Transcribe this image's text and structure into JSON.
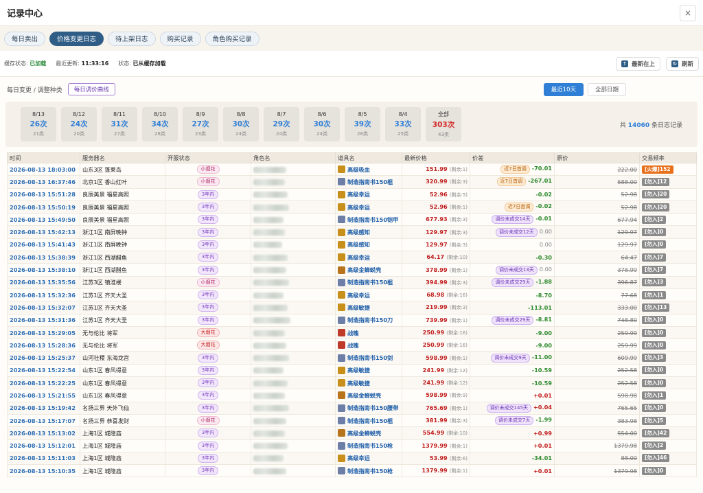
{
  "window": {
    "title": "记录中心",
    "close": "×"
  },
  "tabs": [
    {
      "label": "每日卖出"
    },
    {
      "label": "价格变更日志",
      "active": true
    },
    {
      "label": "待上架日志"
    },
    {
      "label": "购买记录"
    },
    {
      "label": "角色购买记录"
    }
  ],
  "status": {
    "cache_label": "缓存状态:",
    "cache_value": "已加载",
    "update_label": "最近更新:",
    "update_value": "11:33:16",
    "state_label": "状态:",
    "state_value": "已从缓存加载",
    "latest_first": "最新在上",
    "refresh": "刷新"
  },
  "filter": {
    "label": "每日变更 / 调整种类",
    "curve_button": "每日调价曲线",
    "range_recent": "最近10天",
    "range_all": "全部日期",
    "total_prefix": "共",
    "total_count": "14060",
    "total_suffix": "条日志记录"
  },
  "days": [
    {
      "date": "8/13",
      "count": "26次",
      "kinds": "21类"
    },
    {
      "date": "8/12",
      "count": "24次",
      "kinds": "20类"
    },
    {
      "date": "8/11",
      "count": "31次",
      "kinds": "27类"
    },
    {
      "date": "8/10",
      "count": "34次",
      "kinds": "28类"
    },
    {
      "date": "8/9",
      "count": "27次",
      "kinds": "23类"
    },
    {
      "date": "8/8",
      "count": "30次",
      "kinds": "24类"
    },
    {
      "date": "8/7",
      "count": "29次",
      "kinds": "24类"
    },
    {
      "date": "8/6",
      "count": "30次",
      "kinds": "24类"
    },
    {
      "date": "8/5",
      "count": "39次",
      "kinds": "28类"
    },
    {
      "date": "8/4",
      "count": "33次",
      "kinds": "25类"
    },
    {
      "date": "全部",
      "count": "303次",
      "kinds": "43类",
      "all": true
    }
  ],
  "columns": [
    "时间",
    "服务器名",
    "开服状态",
    "角色名",
    "道具名",
    "最新价格",
    "价差",
    "原价",
    "交易频率"
  ],
  "icon_colors": {
    "gold": "#c8901a",
    "book": "#6d7fa6",
    "bug": "#b8741a",
    "red": "#c03a2a"
  },
  "rows": [
    {
      "time": "2026-08-13 18:03:00",
      "server": "山东3区 蓬莱岛",
      "status": "小烟花",
      "st": "ps",
      "item": "高级吸血",
      "icon": "gold",
      "price": "151.99",
      "rem": "(剩余:1)",
      "tag": "近7日首调",
      "tt": "first",
      "diff": "-70.01",
      "dk": "neg",
      "orig": "222.00",
      "freq": "[火爆]152",
      "hot": true
    },
    {
      "time": "2026-08-13 16:37:46",
      "server": "北京1区 香山红叶",
      "status": "小烟花",
      "st": "ps",
      "item": "制造指南书150棍",
      "icon": "book",
      "price": "320.99",
      "rem": "(剩余:3)",
      "tag": "近7日首调",
      "tt": "first",
      "diff": "-267.01",
      "dk": "neg",
      "orig": "588.00",
      "freq": "[勿入]12"
    },
    {
      "time": "2026-08-13 15:51:28",
      "server": "良辰美景 福星高照",
      "status": "3年内",
      "st": "p3",
      "item": "高级幸运",
      "icon": "gold",
      "price": "52.96",
      "rem": "(剩余:5)",
      "tag": "",
      "tt": "",
      "diff": "-0.02",
      "dk": "neg",
      "orig": "52.98",
      "freq": "[勿入]20"
    },
    {
      "time": "2026-08-13 15:50:19",
      "server": "良辰美景 福星高照",
      "status": "3年内",
      "st": "p3",
      "item": "高级幸运",
      "icon": "gold",
      "price": "52.96",
      "rem": "(剩余:1)",
      "tag": "近7日首调",
      "tt": "first",
      "diff": "-0.02",
      "dk": "neg",
      "orig": "52.98",
      "freq": "[勿入]20"
    },
    {
      "time": "2026-08-13 15:49:50",
      "server": "良辰美景 福星高照",
      "status": "3年内",
      "st": "p3",
      "item": "制造指南书150铠甲",
      "icon": "book",
      "price": "677.93",
      "rem": "(剩余:3)",
      "tag": "调价未成交14天",
      "tt": "none",
      "diff": "-0.01",
      "dk": "neg",
      "orig": "677.94",
      "freq": "[勿入]2"
    },
    {
      "time": "2026-08-13 15:42:13",
      "server": "浙江1区 南屏晚钟",
      "status": "3年内",
      "st": "p3",
      "item": "高级感知",
      "icon": "gold",
      "price": "129.97",
      "rem": "(剩余:3)",
      "tag": "调价未成交12天",
      "tt": "none",
      "diff": "0.00",
      "dk": "zero",
      "orig": "129.97",
      "freq": "[勿入]0"
    },
    {
      "time": "2026-08-13 15:41:43",
      "server": "浙江1区 南屏晚钟",
      "status": "3年内",
      "st": "p3",
      "item": "高级感知",
      "icon": "gold",
      "price": "129.97",
      "rem": "(剩余:3)",
      "tag": "",
      "tt": "",
      "diff": "0.00",
      "dk": "zero",
      "orig": "129.97",
      "freq": "[勿入]0"
    },
    {
      "time": "2026-08-13 15:38:39",
      "server": "浙江1区 西湖醋鱼",
      "status": "3年内",
      "st": "p3",
      "item": "高级幸运",
      "icon": "gold",
      "price": "64.17",
      "rem": "(剩余:10)",
      "tag": "",
      "tt": "",
      "diff": "-0.30",
      "dk": "neg",
      "orig": "64.47",
      "freq": "[勿入]7"
    },
    {
      "time": "2026-08-13 15:38:10",
      "server": "浙江1区 西湖醋鱼",
      "status": "3年内",
      "st": "p3",
      "item": "高级金蝉蜕壳",
      "icon": "bug",
      "price": "378.99",
      "rem": "(剩余:1)",
      "tag": "调价未成交13天",
      "tt": "none",
      "diff": "0.00",
      "dk": "zero",
      "orig": "378.99",
      "freq": "[勿入]7"
    },
    {
      "time": "2026-08-13 15:35:56",
      "server": "江苏3区 镇淮楼",
      "status": "小烟花",
      "st": "ps",
      "item": "制造指南书150棍",
      "icon": "book",
      "price": "394.99",
      "rem": "(剩余:3)",
      "tag": "调价未成交29天",
      "tt": "none",
      "diff": "-1.88",
      "dk": "neg",
      "orig": "396.87",
      "freq": "[勿入]3"
    },
    {
      "time": "2026-08-13 15:32:36",
      "server": "江苏1区 齐天大圣",
      "status": "3年内",
      "st": "p3",
      "item": "高级幸运",
      "icon": "gold",
      "price": "68.98",
      "rem": "(剩余:16)",
      "tag": "",
      "tt": "",
      "diff": "-8.70",
      "dk": "neg",
      "orig": "77.68",
      "freq": "[勿入]1"
    },
    {
      "time": "2026-08-13 15:32:07",
      "server": "江苏1区 齐天大圣",
      "status": "3年内",
      "st": "p3",
      "item": "高级敏捷",
      "icon": "gold",
      "price": "219.99",
      "rem": "(剩余:3)",
      "tag": "",
      "tt": "",
      "diff": "-113.01",
      "dk": "neg",
      "orig": "333.00",
      "freq": "[勿入]13"
    },
    {
      "time": "2026-08-13 15:31:36",
      "server": "江苏1区 齐天大圣",
      "status": "3年内",
      "st": "p3",
      "item": "制造指南书150刀",
      "icon": "book",
      "price": "739.99",
      "rem": "(剩余:1)",
      "tag": "调价未成交29天",
      "tt": "none",
      "diff": "-8.81",
      "dk": "neg",
      "orig": "748.80",
      "freq": "[勿入]0"
    },
    {
      "time": "2026-08-13 15:29:05",
      "server": "无与伦比 将军",
      "status": "大烟花",
      "st": "pb",
      "item": "战魄",
      "icon": "red",
      "price": "250.99",
      "rem": "(剩余:16)",
      "tag": "",
      "tt": "",
      "diff": "-9.00",
      "dk": "neg",
      "orig": "259.99",
      "freq": "[勿入]0"
    },
    {
      "time": "2026-08-13 15:28:36",
      "server": "无与伦比 将军",
      "status": "大烟花",
      "st": "pb",
      "item": "战魄",
      "icon": "red",
      "price": "250.99",
      "rem": "(剩余:16)",
      "tag": "",
      "tt": "",
      "diff": "-9.00",
      "dk": "neg",
      "orig": "259.99",
      "freq": "[勿入]0"
    },
    {
      "time": "2026-08-13 15:25:37",
      "server": "山河社稷 东海龙宫",
      "status": "3年内",
      "st": "p3",
      "item": "制造指南书150剑",
      "icon": "book",
      "price": "598.99",
      "rem": "(剩余:1)",
      "tag": "调价未成交9天",
      "tt": "none",
      "diff": "-11.00",
      "dk": "neg",
      "orig": "609.99",
      "freq": "[勿入]3"
    },
    {
      "time": "2026-08-13 15:22:54",
      "server": "山东1区 春风得意",
      "status": "3年内",
      "st": "p3",
      "item": "高级敏捷",
      "icon": "gold",
      "price": "241.99",
      "rem": "(剩余:12)",
      "tag": "",
      "tt": "",
      "diff": "-10.59",
      "dk": "neg",
      "orig": "252.58",
      "freq": "[勿入]0"
    },
    {
      "time": "2026-08-13 15:22:25",
      "server": "山东1区 春风得意",
      "status": "3年内",
      "st": "p3",
      "item": "高级敏捷",
      "icon": "gold",
      "price": "241.99",
      "rem": "(剩余:12)",
      "tag": "",
      "tt": "",
      "diff": "-10.59",
      "dk": "neg",
      "orig": "252.58",
      "freq": "[勿入]0"
    },
    {
      "time": "2026-08-13 15:21:55",
      "server": "山东1区 春风得意",
      "status": "3年内",
      "st": "p3",
      "item": "高级金蝉蜕壳",
      "icon": "bug",
      "price": "598.99",
      "rem": "(剩余:9)",
      "tag": "",
      "tt": "",
      "diff": "+0.01",
      "dk": "pos",
      "orig": "598.98",
      "freq": "[勿入]1"
    },
    {
      "time": "2026-08-13 15:19:42",
      "server": "名扬三界 天外飞仙",
      "status": "3年内",
      "st": "p3",
      "item": "制造指南书150腰带",
      "icon": "book",
      "price": "765.69",
      "rem": "(剩余:1)",
      "tag": "调价未成交145天",
      "tt": "none",
      "diff": "+0.04",
      "dk": "pos",
      "orig": "765.65",
      "freq": "[勿入]0"
    },
    {
      "time": "2026-08-13 15:17:07",
      "server": "名扬三界 恭喜发财",
      "status": "小烟花",
      "st": "ps",
      "item": "制造指南书150棍",
      "icon": "book",
      "price": "381.99",
      "rem": "(剩余:3)",
      "tag": "调价未成交7天",
      "tt": "none",
      "diff": "-1.99",
      "dk": "neg",
      "orig": "383.98",
      "freq": "[勿入]5"
    },
    {
      "time": "2026-08-13 15:13:02",
      "server": "上海1区 城隍庙",
      "status": "3年内",
      "st": "p3",
      "item": "高级金蝉蜕壳",
      "icon": "bug",
      "price": "554.99",
      "rem": "(剩余:10)",
      "tag": "",
      "tt": "",
      "diff": "+0.99",
      "dk": "pos",
      "orig": "554.00",
      "freq": "[勿入]42"
    },
    {
      "time": "2026-08-13 15:12:01",
      "server": "上海1区 城隍庙",
      "status": "3年内",
      "st": "p3",
      "item": "制造指南书150枪",
      "icon": "book",
      "price": "1379.99",
      "rem": "(剩余:1)",
      "tag": "",
      "tt": "",
      "diff": "+0.01",
      "dk": "pos",
      "orig": "1379.98",
      "freq": "[勿入]2"
    },
    {
      "time": "2026-08-13 15:11:03",
      "server": "上海1区 城隍庙",
      "status": "3年内",
      "st": "p3",
      "item": "高级幸运",
      "icon": "gold",
      "price": "53.99",
      "rem": "(剩余:6)",
      "tag": "",
      "tt": "",
      "diff": "-34.01",
      "dk": "neg",
      "orig": "88.00",
      "freq": "[勿入]46"
    },
    {
      "time": "2026-08-13 15:10:35",
      "server": "上海1区 城隍庙",
      "status": "3年内",
      "st": "p3",
      "item": "制造指南书150枪",
      "icon": "book",
      "price": "1379.99",
      "rem": "(剩余:1)",
      "tag": "",
      "tt": "",
      "diff": "+0.01",
      "dk": "pos",
      "orig": "1379.98",
      "freq": "[勿入]0"
    }
  ]
}
